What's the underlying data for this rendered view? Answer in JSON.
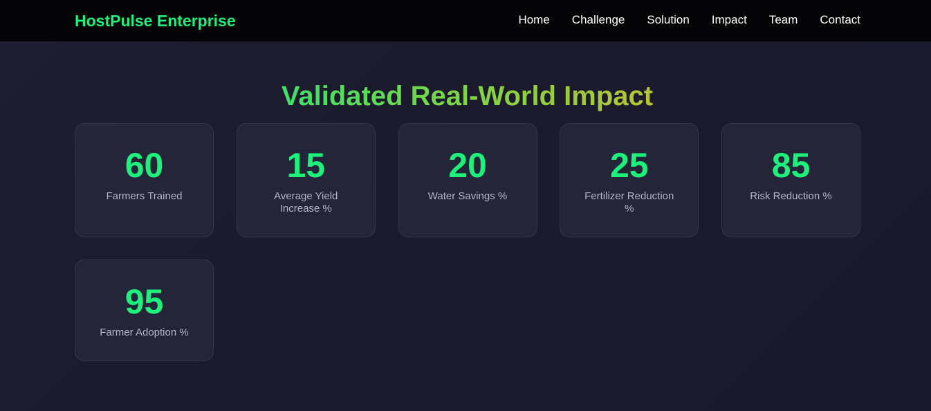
{
  "nav": {
    "brand": "HostPulse Enterprise",
    "links": [
      "Home",
      "Challenge",
      "Solution",
      "Impact",
      "Team",
      "Contact"
    ]
  },
  "section": {
    "title": "Validated Real-World Impact"
  },
  "stats": [
    {
      "value": "60",
      "label": "Farmers Trained"
    },
    {
      "value": "15",
      "label": "Average Yield Increase %"
    },
    {
      "value": "20",
      "label": "Water Savings %"
    },
    {
      "value": "25",
      "label": "Fertilizer Reduction %"
    },
    {
      "value": "85",
      "label": "Risk Reduction %"
    },
    {
      "value": "95",
      "label": "Farmer Adoption %"
    }
  ],
  "colors": {
    "accent": "#1ef07c",
    "background": "#1a1a2c",
    "card": "#25253a",
    "navbar": "#050508"
  }
}
